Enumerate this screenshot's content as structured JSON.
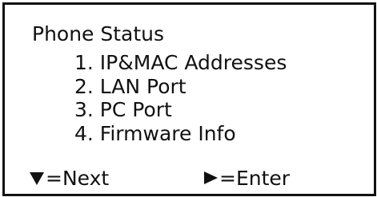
{
  "screen": {
    "title": "Phone Status"
  },
  "menu": {
    "items": [
      {
        "label": "1. IP&MAC Addresses"
      },
      {
        "label": "2. LAN Port"
      },
      {
        "label": "3. PC Port"
      },
      {
        "label": "4. Firmware Info"
      }
    ]
  },
  "footer": {
    "next": {
      "icon": "down-triangle-icon",
      "label": "=Next"
    },
    "enter": {
      "icon": "right-triangle-icon",
      "label": "=Enter"
    }
  }
}
